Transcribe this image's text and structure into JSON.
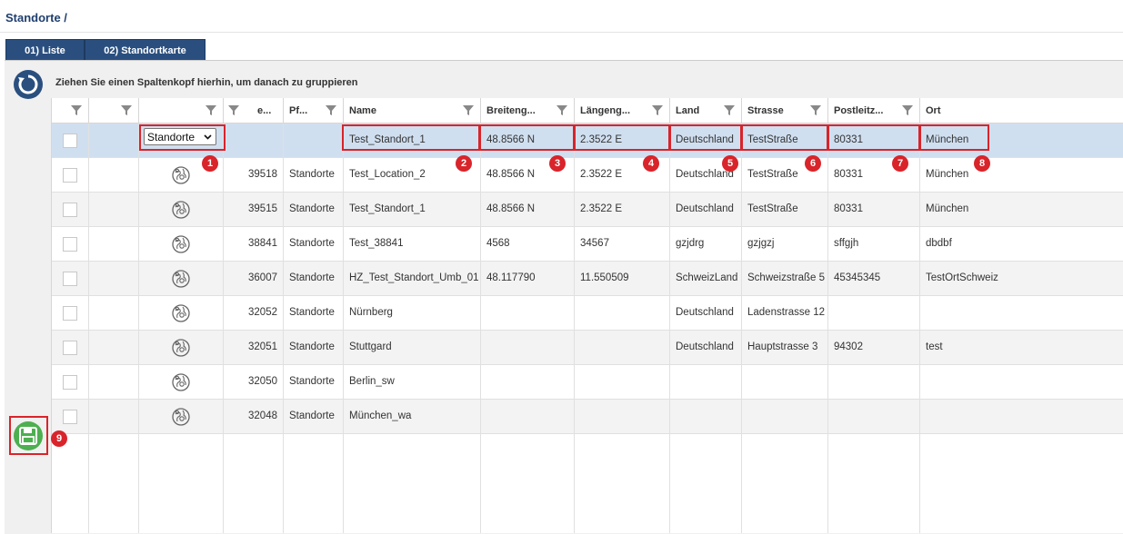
{
  "breadcrumb": "Standorte /",
  "tabs": [
    {
      "label": "01) Liste"
    },
    {
      "label": "02) Standortkarte"
    }
  ],
  "group_hint": "Ziehen Sie einen Spaltenkopf hierhin, um danach zu gruppieren",
  "columns": [
    {
      "label": ""
    },
    {
      "label": ""
    },
    {
      "label": ""
    },
    {
      "label": "e..."
    },
    {
      "label": "Pf..."
    },
    {
      "label": "Name"
    },
    {
      "label": "Breiteng..."
    },
    {
      "label": "Längeng..."
    },
    {
      "label": "Land"
    },
    {
      "label": "Strasse"
    },
    {
      "label": "Postleitz..."
    },
    {
      "label": "Ort"
    }
  ],
  "edit_row": {
    "type_select": "Standorte",
    "name": "Test_Standort_1",
    "lat": "48.8566 N",
    "lon": "2.3522 E",
    "land": "Deutschland",
    "strasse": "TestStraße",
    "plz": "80331",
    "ort": "München"
  },
  "rows": [
    {
      "id": "39518",
      "pf": "Standorte",
      "name": "Test_Location_2",
      "lat": "48.8566 N",
      "lon": "2.3522 E",
      "land": "Deutschland",
      "strasse": "TestStraße",
      "plz": "80331",
      "ort": "München"
    },
    {
      "id": "39515",
      "pf": "Standorte",
      "name": "Test_Standort_1",
      "lat": "48.8566 N",
      "lon": "2.3522 E",
      "land": "Deutschland",
      "strasse": "TestStraße",
      "plz": "80331",
      "ort": "München"
    },
    {
      "id": "38841",
      "pf": "Standorte",
      "name": "Test_38841",
      "lat": "4568",
      "lon": "34567",
      "land": "gzjdrg",
      "strasse": "gzjgzj",
      "plz": "sffgjh",
      "ort": "dbdbf"
    },
    {
      "id": "36007",
      "pf": "Standorte",
      "name": "HZ_Test_Standort_Umb_01",
      "lat": "48.117790",
      "lon": "11.550509",
      "land": "SchweizLand",
      "strasse": "Schweizstraße 5",
      "plz": "45345345",
      "ort": "TestOrtSchweiz"
    },
    {
      "id": "32052",
      "pf": "Standorte",
      "name": "Nürnberg",
      "lat": "",
      "lon": "",
      "land": "Deutschland",
      "strasse": "Ladenstrasse 12",
      "plz": "",
      "ort": ""
    },
    {
      "id": "32051",
      "pf": "Standorte",
      "name": "Stuttgard",
      "lat": "",
      "lon": "",
      "land": "Deutschland",
      "strasse": "Hauptstrasse 3",
      "plz": "94302",
      "ort": "test"
    },
    {
      "id": "32050",
      "pf": "Standorte",
      "name": "Berlin_sw",
      "lat": "",
      "lon": "",
      "land": "",
      "strasse": "",
      "plz": "",
      "ort": ""
    },
    {
      "id": "32048",
      "pf": "Standorte",
      "name": "München_wa",
      "lat": "",
      "lon": "",
      "land": "",
      "strasse": "",
      "plz": "",
      "ort": ""
    }
  ],
  "badges": [
    "1",
    "2",
    "3",
    "4",
    "5",
    "6",
    "7",
    "8",
    "9"
  ],
  "colors": {
    "header_blue": "#2a4f7f",
    "selected_row": "#d0dff0",
    "annotation_red": "#d8242a",
    "save_green": "#4caf50"
  },
  "icons": {
    "refresh": "refresh-icon",
    "filter": "filter-icon",
    "location": "location-globe-icon",
    "save": "save-icon"
  }
}
